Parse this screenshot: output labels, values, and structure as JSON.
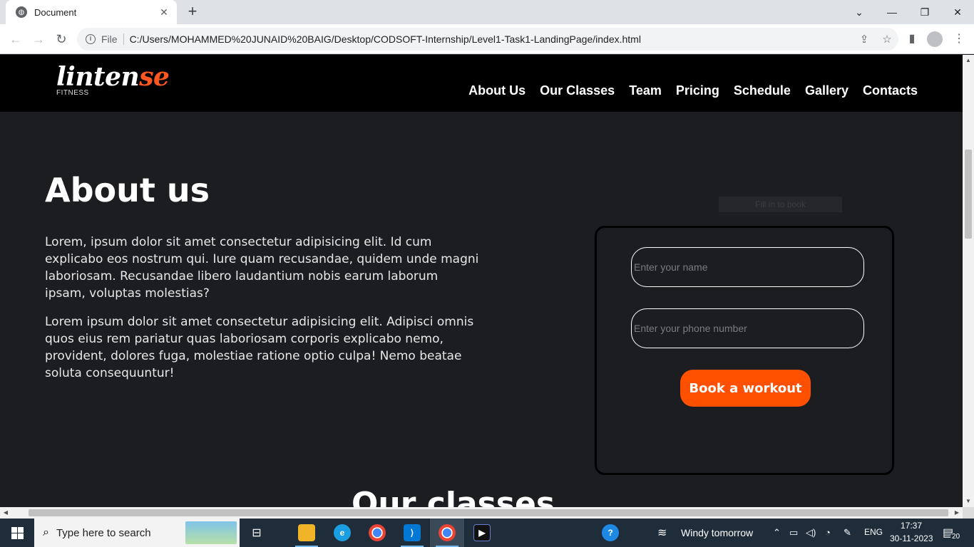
{
  "browser": {
    "tab_title": "Document",
    "tab_close": "✕",
    "new_tab": "+",
    "url_scheme": "File",
    "url": "C:/Users/MOHAMMED%20JUNAID%20BAIG/Desktop/CODSOFT-Internship/Level1-Task1-LandingPage/index.html"
  },
  "site": {
    "logo_main": "linten",
    "logo_accent": "se",
    "logo_sub": "FITNESS",
    "nav": [
      "About Us",
      "Our Classes",
      "Team",
      "Pricing",
      "Schedule",
      "Gallery",
      "Contacts"
    ]
  },
  "about": {
    "title": "About us",
    "para1": "Lorem, ipsum dolor sit amet consectetur adipisicing elit. Id cum explicabo eos nostrum qui. Iure quam recusandae, quidem unde magni laboriosam. Recusandae libero laudantium nobis earum laborum ipsam, voluptas molestias?",
    "para2": "Lorem ipsum dolor sit amet consectetur adipisicing elit. Adipisci omnis quos eius rem pariatur quas laboriosam corporis explicabo nemo, provident, dolores fuga, molestiae ratione optio culpa! Nemo beatae soluta consequuntur!"
  },
  "form": {
    "ghost_text": "Fill in to book",
    "name_placeholder": "Enter your name",
    "phone_placeholder": "Enter your phone number",
    "button": "Book a workout"
  },
  "classes": {
    "title": "Our classes"
  },
  "taskbar": {
    "search_placeholder": "Type here to search",
    "weather": "Windy tomorrow",
    "lang": "ENG",
    "time": "17:37",
    "date": "30-11-2023",
    "notifications": "20"
  }
}
